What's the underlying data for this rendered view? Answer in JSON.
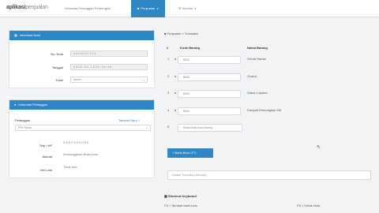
{
  "nav": {
    "brand_bold": "aplikasi",
    "brand_light": "penjualan",
    "link1": "Informasi Pelanggan Perbengkel",
    "active": "Penjualan",
    "link3": "Service"
  },
  "faktur_panel": {
    "title": "Informasi Nota",
    "no_nota_label": "No. Nota",
    "no_nota_value": "0 9 1 0 0 0 0 1 0 1",
    "tanggal_label": "Tanggal",
    "tanggal_value": "2 0 1 6 - 0 4 - 1 6 1 6 : 1 6 : 4 6",
    "kasir_label": "Kasir",
    "kasir_value": "Admin"
  },
  "pelanggan_panel": {
    "title": "Informasi Pelanggan",
    "pelanggan_label": "Pelanggan",
    "tambah_baru": "Tambah Baru ?",
    "pelanggan_select": "Pilih Nama",
    "telp_label": "Telp / HP",
    "telp_value": "0 8 5 7 2 0 0 0 0 0",
    "alamat_label": "Alamat",
    "alamat_value": "Kemanggisan Brata kota",
    "info_label": "Info Lain",
    "info_value": "Tidak ada"
  },
  "breadcrumb": "Penjualan  >  Transaksi",
  "table": {
    "col_no": "#",
    "col_kode": "Kode Barang",
    "col_nama": "Nama Barang",
    "rows": [
      {
        "no": "1",
        "kode": "B001",
        "nama": "Gerah Harian"
      },
      {
        "no": "2",
        "kode": "B002",
        "nama": "Ovaria"
      },
      {
        "no": "3",
        "kode": "B003",
        "nama": "Sabun Lipatan"
      },
      {
        "no": "4",
        "kode": "B004",
        "nama": "Dompet Kemungkan HB"
      },
      {
        "no": "5",
        "kode": "Mulai ketik kode barang...",
        "nama": ""
      }
    ]
  },
  "buttons": {
    "baris_baru": "+ Baris Baru (F7)"
  },
  "kolom_placeholder": "Catatan Transaksi (Jika ada)",
  "payment": {
    "title": "Shortcut Keyboard",
    "left": "F3 = Tambah baris baru",
    "right": "F8 = Cetak Nota"
  },
  "colors": {
    "accent": "#2e86c4"
  }
}
